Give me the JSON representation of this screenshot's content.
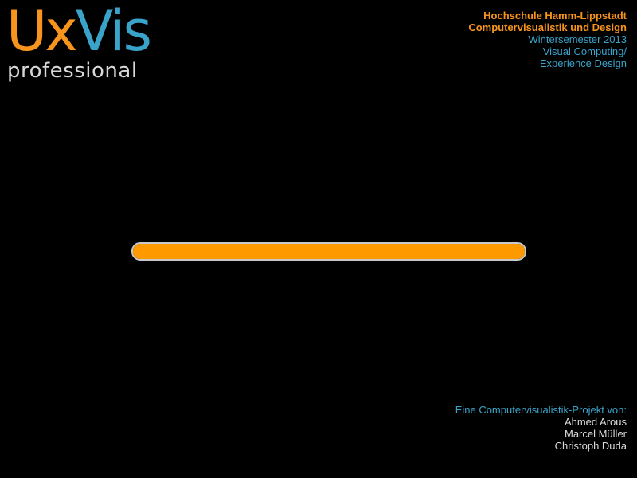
{
  "logo": {
    "part_ux": "Ux",
    "part_vis": "Vis",
    "subtitle": "professional"
  },
  "header_info": {
    "lines": [
      "Hochschule Hamm-Lippstadt",
      "Computervisualistik und Design",
      "Wintersemester 2013",
      "Visual Computing/",
      "Experience Design"
    ]
  },
  "loading": {
    "progress": 1.0
  },
  "credits": {
    "intro": "Eine Computervisualistik-Projekt von:",
    "names": [
      "Ahmed Arous",
      "Marcel Müller",
      "Christoph Duda"
    ]
  },
  "colors": {
    "background": "#000000",
    "accent_orange": "#f7941d",
    "accent_blue": "#3aa3c9",
    "progress_fill": "#ff9900",
    "progress_border": "#c8c8c8",
    "text_grey": "#dcdcdc"
  }
}
